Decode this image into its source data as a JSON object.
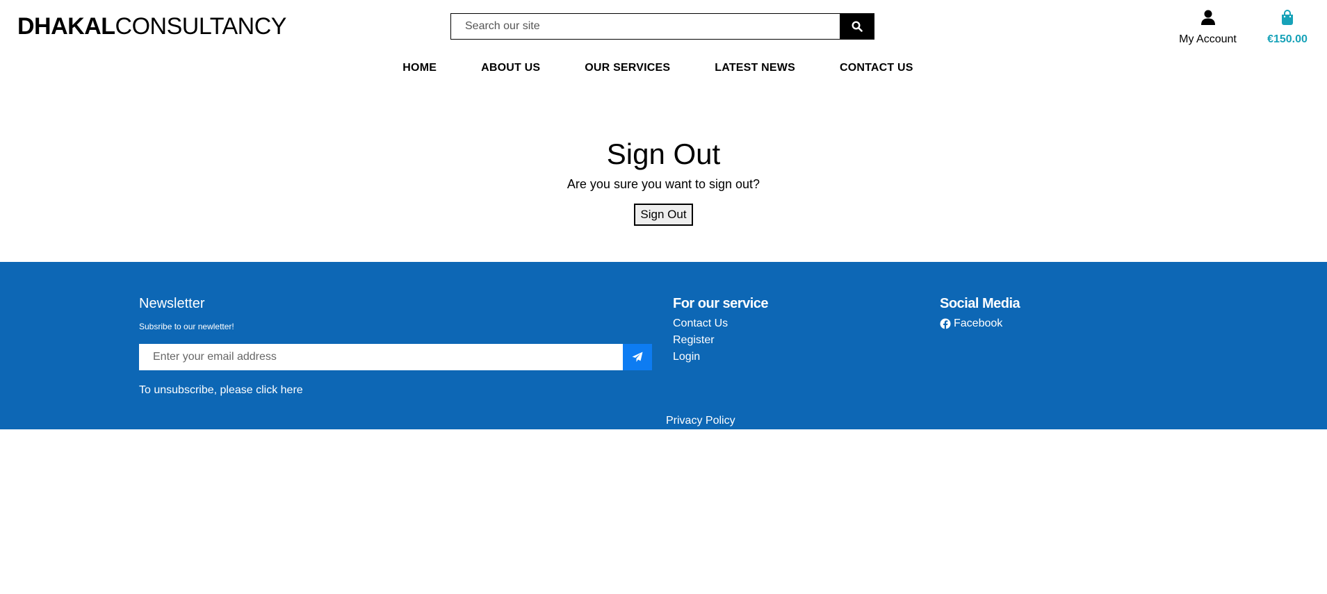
{
  "brand": {
    "bold": "DHAKAL",
    "light": "CONSULTANCY"
  },
  "search": {
    "placeholder": "Search our site",
    "value": ""
  },
  "account": {
    "label": "My Account"
  },
  "cart": {
    "total": "€150.00"
  },
  "nav": {
    "items": [
      {
        "label": "HOME"
      },
      {
        "label": "ABOUT US"
      },
      {
        "label": "OUR SERVICES"
      },
      {
        "label": "LATEST NEWS"
      },
      {
        "label": "CONTACT US"
      }
    ]
  },
  "main": {
    "title": "Sign Out",
    "question": "Are you sure you want to sign out?",
    "button_label": "Sign Out"
  },
  "footer": {
    "newsletter": {
      "title": "Newsletter",
      "subtitle": "Subsribe to our newletter!",
      "email_placeholder": "Enter your email address",
      "unsubscribe": "To unsubscribe, please click here"
    },
    "service": {
      "title": "For our service",
      "links": [
        {
          "label": "Contact Us"
        },
        {
          "label": "Register"
        },
        {
          "label": "Login"
        }
      ]
    },
    "social": {
      "title": "Social Media",
      "links": [
        {
          "label": "Facebook"
        }
      ]
    },
    "privacy": "Privacy Policy"
  },
  "colors": {
    "footer_bg": "#0d67b5",
    "cart_accent": "#17a2b8",
    "send_button": "#0d7cf2"
  }
}
